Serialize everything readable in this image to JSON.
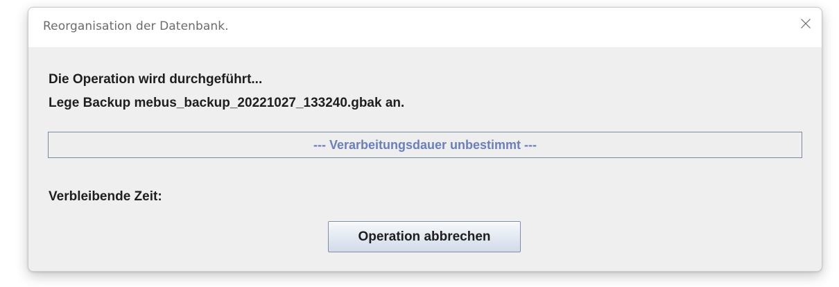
{
  "window": {
    "title": "Reorganisation der Datenbank."
  },
  "icons": {
    "close": "close-icon"
  },
  "status": {
    "operation_text": "Die Operation wird durchgeführt...",
    "backup_text": "Lege Backup mebus_backup_20221027_133240.gbak an."
  },
  "progress": {
    "text": "--- Verarbeitungsdauer unbestimmt ---",
    "indeterminate": true,
    "text_color": "#6a7fbb"
  },
  "remaining": {
    "label": "Verbleibende Zeit:"
  },
  "actions": {
    "cancel_label": "Operation abbrechen"
  }
}
